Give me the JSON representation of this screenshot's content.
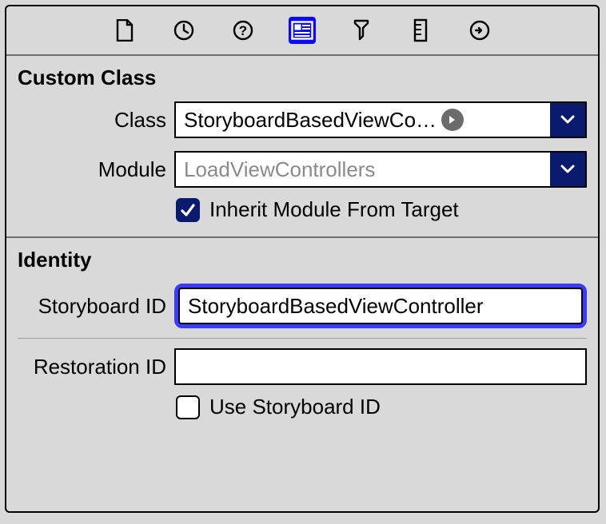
{
  "toolbar": {
    "tabs": [
      "file",
      "history",
      "quick-help",
      "identity",
      "attributes",
      "size",
      "connections"
    ],
    "selected": "identity"
  },
  "customClass": {
    "title": "Custom Class",
    "classLabel": "Class",
    "classValue": "StoryboardBasedViewCo…",
    "moduleLabel": "Module",
    "modulePlaceholder": "LoadViewControllers",
    "inheritLabel": "Inherit Module From Target",
    "inheritChecked": true
  },
  "identity": {
    "title": "Identity",
    "storyboardIdLabel": "Storyboard ID",
    "storyboardIdValue": "StoryboardBasedViewController",
    "restorationIdLabel": "Restoration ID",
    "restorationIdValue": "",
    "useStoryboardIdLabel": "Use Storyboard ID",
    "useStoryboardIdChecked": false
  }
}
